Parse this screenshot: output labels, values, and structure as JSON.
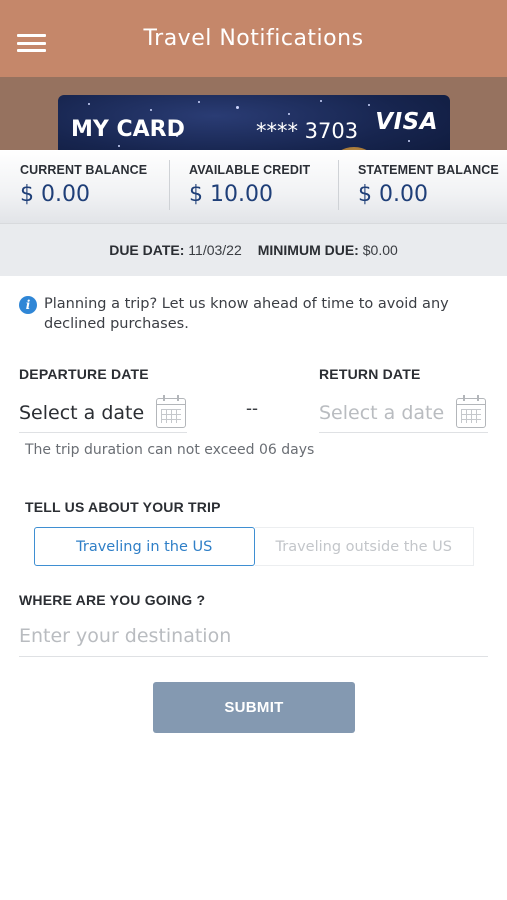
{
  "header": {
    "title": "Travel Notifications",
    "menu_icon": "hamburger-menu-icon",
    "background_color": "#c5876a"
  },
  "card": {
    "name": "MY CARD",
    "number": "**** 3703",
    "brand": "VISA"
  },
  "balances": [
    {
      "label": "CURRENT BALANCE",
      "value": "$ 0.00"
    },
    {
      "label": "AVAILABLE CREDIT",
      "value": "$ 10.00"
    },
    {
      "label": "STATEMENT BALANCE",
      "value": "$ 0.00"
    }
  ],
  "due": {
    "due_date_label": "DUE DATE:",
    "due_date_value": "11/03/22",
    "minimum_due_label": "MINIMUM DUE:",
    "minimum_due_value": "$0.00"
  },
  "info": {
    "icon": "info-icon",
    "text": "Planning a trip? Let us know ahead of time to avoid any declined purchases."
  },
  "dates": {
    "departure_label": "DEPARTURE DATE",
    "departure_placeholder": "Select a date",
    "return_label": "RETURN DATE",
    "return_placeholder": "Select a date",
    "separator": "--",
    "hint": "The trip duration can not exceed 06 days",
    "calendar_icon": "calendar-icon"
  },
  "trip": {
    "label": "TELL US ABOUT YOUR TRIP",
    "options": [
      "Traveling in the US",
      "Traveling outside the US"
    ],
    "selected": "Traveling in the US",
    "active_color": "#3f8fd2"
  },
  "destination": {
    "label": "WHERE ARE YOU GOING ?",
    "placeholder": "Enter your destination"
  },
  "submit": {
    "label": "SUBMIT",
    "color": "#8499b1"
  }
}
